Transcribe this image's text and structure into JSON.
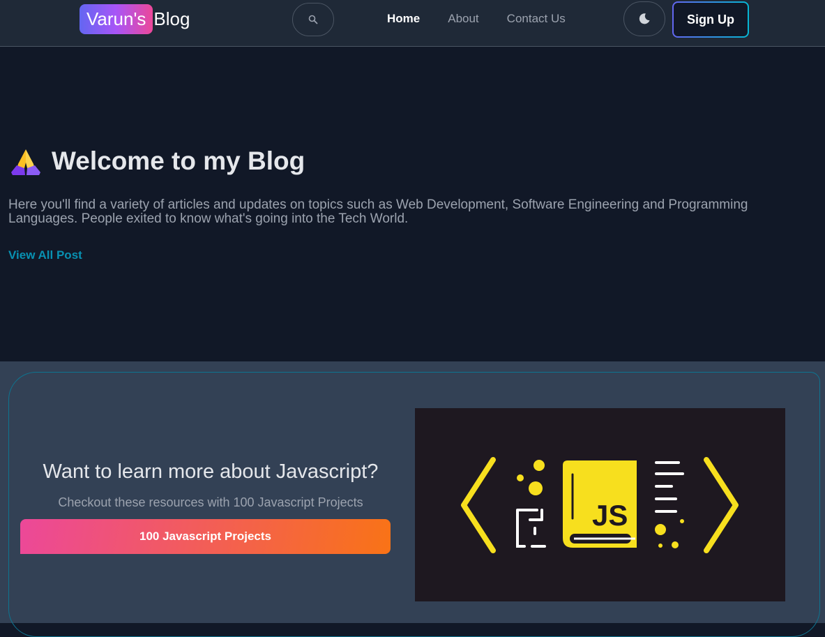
{
  "navbar": {
    "brand_highlight": "Varun's",
    "brand_rest": "Blog",
    "links": [
      {
        "label": "Home",
        "active": true
      },
      {
        "label": "About",
        "active": false
      },
      {
        "label": "Contact Us",
        "active": false
      }
    ],
    "signup_label": "Sign Up",
    "search_icon": "search-icon",
    "theme_icon": "moon-icon"
  },
  "hero": {
    "emoji": "folded-hands-icon",
    "title": "Welcome to my Blog",
    "description": "Here you'll find a variety of articles and updates on topics such as Web Development, Software Engineering and Programming Languages. People exited to know what's going into the Tech World.",
    "link_label": "View All Post"
  },
  "promo": {
    "title": "Want to learn more about Javascript?",
    "subtitle": "Checkout these resources with 100 Javascript Projects",
    "button_label": "100 Javascript Projects",
    "image_text": "JS"
  },
  "colors": {
    "background": "#111827",
    "navbar": "#1f2937",
    "promo_section": "#334155",
    "accent_link": "#0891b2",
    "js_yellow": "#f7df1e"
  }
}
